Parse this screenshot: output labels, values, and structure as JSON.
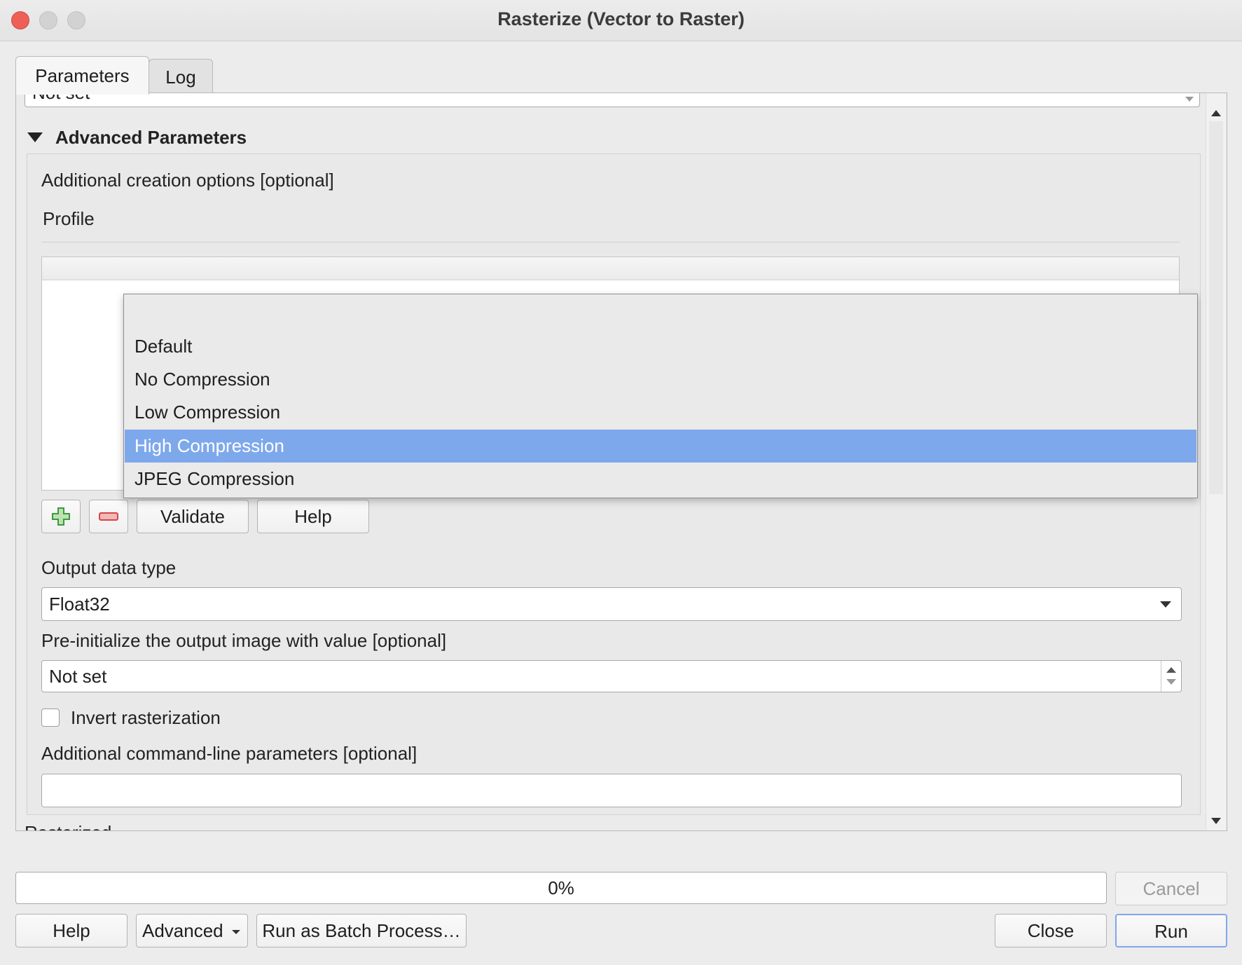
{
  "window": {
    "title": "Rasterize (Vector to Raster)"
  },
  "tabs": [
    {
      "label": "Parameters",
      "active": true
    },
    {
      "label": "Log",
      "active": false
    }
  ],
  "top_cut_field": {
    "value": "Not set"
  },
  "advanced": {
    "header": "Advanced Parameters",
    "creation_options_label": "Additional creation options [optional]",
    "profile_label": "Profile",
    "profile_options": [
      "",
      "Default",
      "No Compression",
      "Low Compression",
      "High Compression",
      "JPEG Compression"
    ],
    "profile_highlighted": "High Compression",
    "buttons": {
      "validate": "Validate",
      "help": "Help"
    },
    "output_type_label": "Output data type",
    "output_type_value": "Float32",
    "preinit_label": "Pre-initialize the output image with value [optional]",
    "preinit_value": "Not set",
    "invert_label": "Invert rasterization",
    "invert_checked": false,
    "cmdline_label": "Additional command-line parameters [optional]",
    "cmdline_value": ""
  },
  "next_section_cut": "Rasterized",
  "progress": {
    "text": "0%",
    "value": 0
  },
  "footer": {
    "cancel": "Cancel",
    "help": "Help",
    "advanced": "Advanced",
    "batch": "Run as Batch Process…",
    "close": "Close",
    "run": "Run"
  },
  "colors": {
    "highlight": "#7ea8ec",
    "close_light": "#ed5f57",
    "add_icon": "#3c9a3c",
    "remove_icon": "#d64545"
  }
}
